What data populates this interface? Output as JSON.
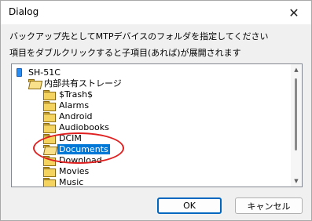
{
  "window": {
    "title": "Dialog",
    "close_symbol": "✕"
  },
  "instructions": {
    "line1": "バックアップ先としてMTPデバイスのフォルダを指定してください",
    "line2": "項目をダブルクリックすると子項目(あれば)が展開されます"
  },
  "tree": {
    "device": {
      "label": "SH-51C",
      "icon": "phone-icon"
    },
    "storage": {
      "label": "内部共有ストレージ",
      "icon": "folder-open-icon"
    },
    "folders": [
      {
        "label": "$Trash$",
        "icon": "folder-icon"
      },
      {
        "label": "Alarms",
        "icon": "folder-icon"
      },
      {
        "label": "Android",
        "icon": "folder-icon"
      },
      {
        "label": "Audiobooks",
        "icon": "folder-icon"
      },
      {
        "label": "DCIM",
        "icon": "folder-icon"
      },
      {
        "label": "Documents",
        "icon": "folder-open-icon",
        "selected": true
      },
      {
        "label": "Download",
        "icon": "folder-icon"
      },
      {
        "label": "Movies",
        "icon": "folder-icon"
      },
      {
        "label": "Music",
        "icon": "folder-icon"
      }
    ]
  },
  "buttons": {
    "ok": "OK",
    "cancel": "キャンセル"
  },
  "annotation": {
    "ellipse_color": "#e02020"
  },
  "colors": {
    "selection": "#0078d7",
    "ok_border": "#0067c0"
  }
}
